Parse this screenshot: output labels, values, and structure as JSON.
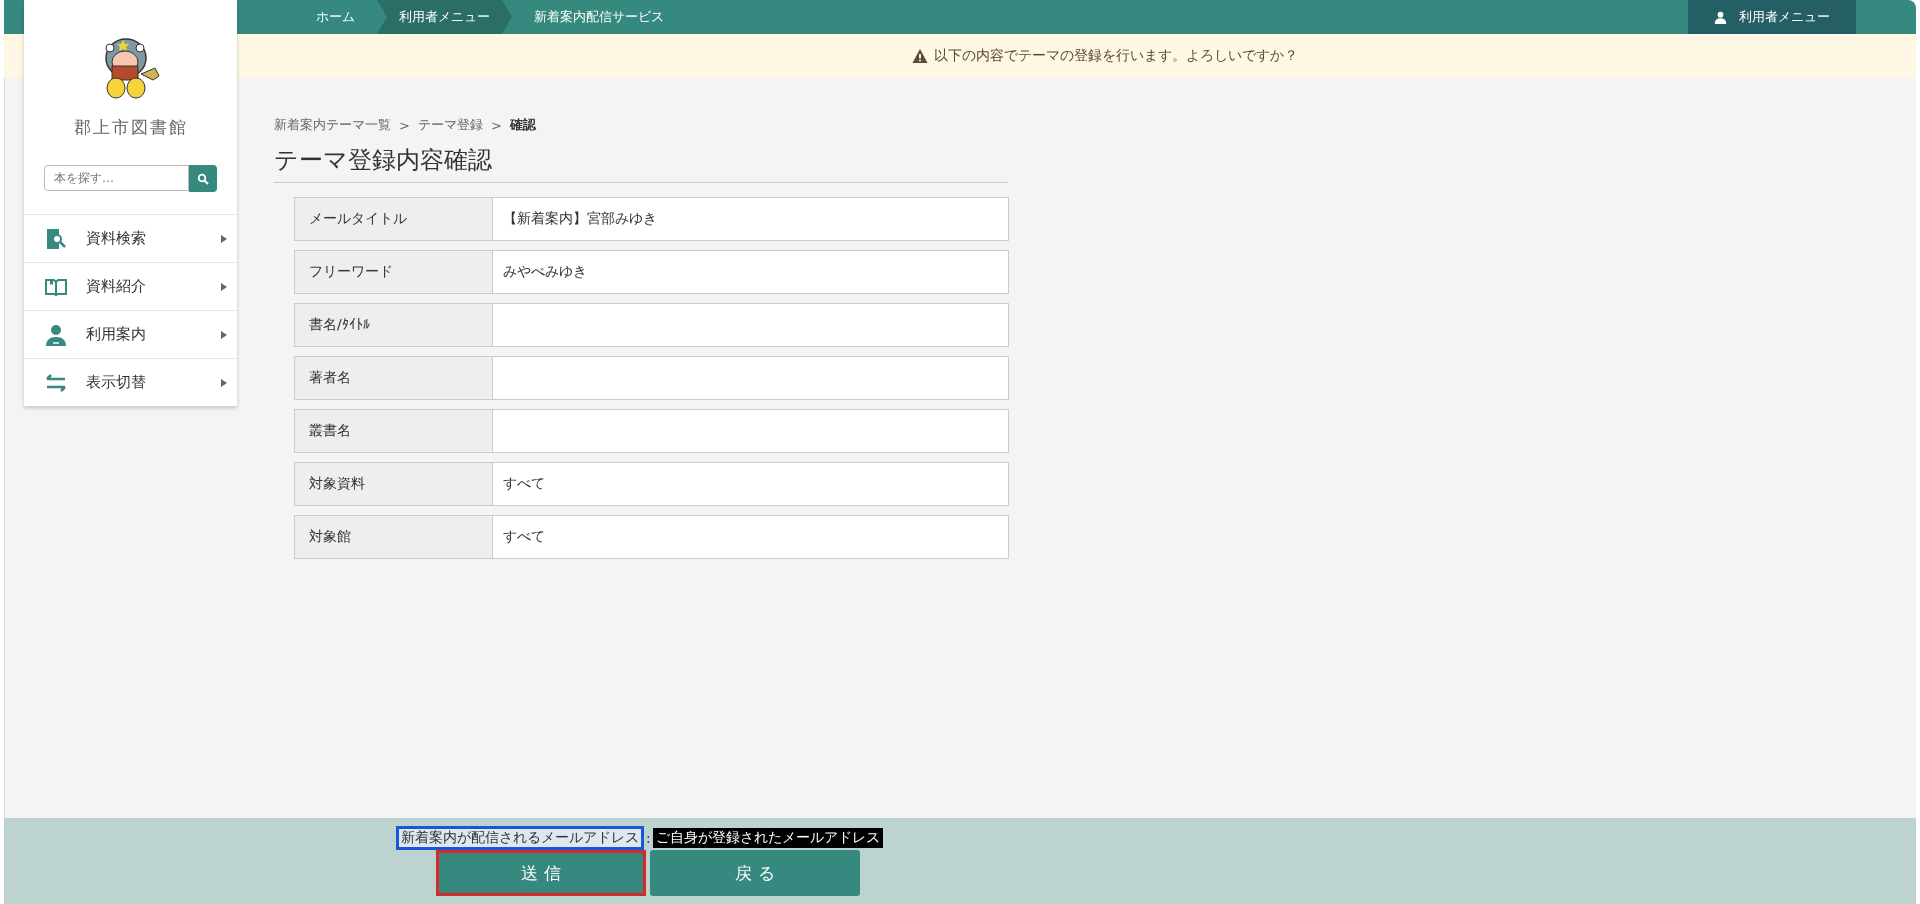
{
  "top_bar": {
    "breadcrumbs": [
      {
        "label": "ホーム",
        "highlighted": false
      },
      {
        "label": "利用者メニュー",
        "highlighted": true
      },
      {
        "label": "新着案内配信サービス",
        "highlighted": false
      }
    ],
    "user_menu": "利用者メニュー"
  },
  "notice": "以下の内容でテーマの登録を行います。よろしいですか？",
  "sidebar": {
    "library_name": "郡上市図書館",
    "search": {
      "placeholder": "本を探す…"
    },
    "items": [
      {
        "kind": "search-doc",
        "label": "資料検索"
      },
      {
        "kind": "book",
        "label": "資料紹介"
      },
      {
        "kind": "person",
        "label": "利用案内"
      },
      {
        "kind": "swap",
        "label": "表示切替"
      }
    ]
  },
  "breadcrumb": [
    {
      "label": "新着案内テーマ一覧",
      "current": false
    },
    {
      "separator": ">",
      "label": "テーマ登録",
      "current": false
    },
    {
      "separator": ">",
      "label": "確認",
      "current": true
    }
  ],
  "page_title": "テーマ登録内容確認",
  "fields": [
    {
      "label": "メールタイトル",
      "value": "【新着案内】宮部みゆき"
    },
    {
      "label": "フリーワード",
      "value": "みやべみゆき"
    },
    {
      "label": "書名/ﾀｲﾄﾙ"
    },
    {
      "label": "著者名"
    },
    {
      "label": "叢書名"
    },
    {
      "label": "対象資料",
      "value": "すべて"
    },
    {
      "label": "対象館",
      "value": "すべて"
    }
  ],
  "footer": {
    "email_label": "新着案内が配信されるメールアドレス",
    "email_label_outlined": true,
    "separator": ":",
    "email_value": "ご自身が登録されたメールアドレス",
    "buttons": [
      {
        "label": "送 信",
        "outlined": true
      },
      {
        "label": "戻 る",
        "outlined": false
      }
    ]
  }
}
